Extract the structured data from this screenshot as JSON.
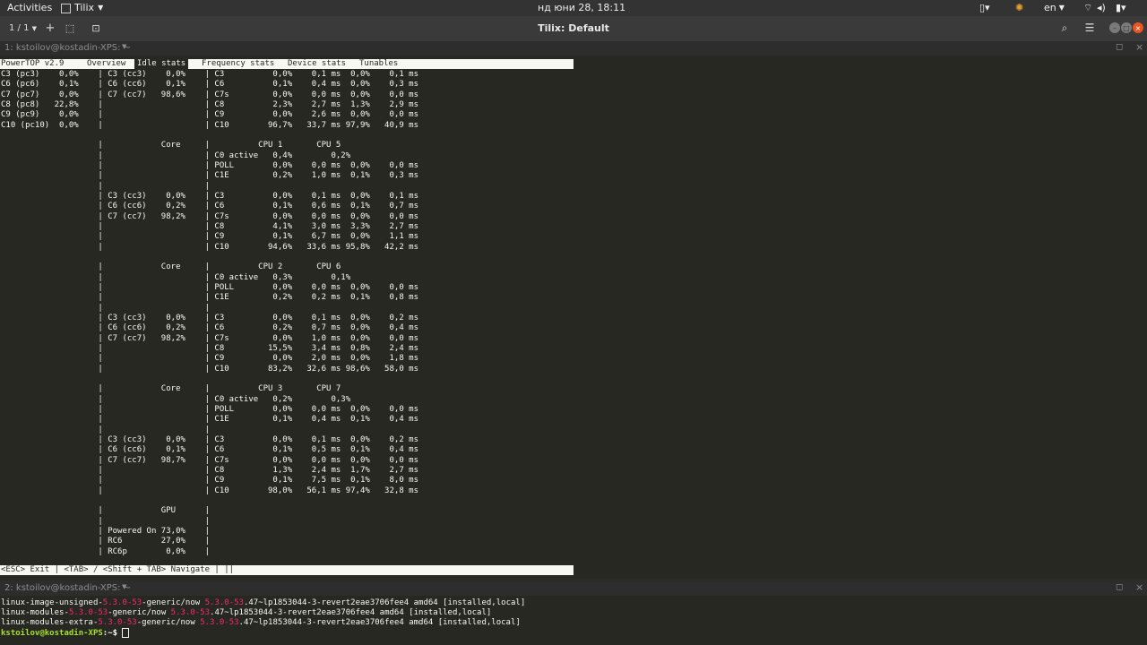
{
  "topbar": {
    "activities": "Activities",
    "app_menu": "Tilix",
    "clock": "нд юни 28, 18:11",
    "lang": "en"
  },
  "titlebar": {
    "session_counter": "1 / 1",
    "title": "Tilix: Default"
  },
  "pane1": {
    "title": "1: kstoilov@kostadin-XPS: ~",
    "tabs": [
      "PowerTOP v2.9",
      "Overview",
      "Idle stats",
      "Frequency stats",
      "Device stats",
      "Tunables"
    ],
    "lines": [
      "C3 (pc3)    0,0%    | C3 (cc3)    0,0%    | C3          0,0%    0,1 ms  0,0%    0,1 ms",
      "C6 (pc6)    0,1%    | C6 (cc6)    0,1%    | C6          0,1%    0,4 ms  0,0%    0,3 ms",
      "C7 (pc7)    0,0%    | C7 (cc7)   98,6%    | C7s         0,0%    0,0 ms  0,0%    0,0 ms",
      "C8 (pc8)   22,8%    |                     | C8          2,3%    2,7 ms  1,3%    2,9 ms",
      "C9 (pc9)    0,0%    |                     | C9          0,0%    2,6 ms  0,0%    0,0 ms",
      "C10 (pc10)  0,0%    |                     | C10        96,7%   33,7 ms 97,9%   40,9 ms",
      "",
      "                    |            Core     |          CPU 1       CPU 5",
      "                    |                     | C0 active   0,4%        0,2%",
      "                    |                     | POLL        0,0%    0,0 ms  0,0%    0,0 ms",
      "                    |                     | C1E         0,2%    1,0 ms  0,1%    0,3 ms",
      "                    |                     |",
      "                    | C3 (cc3)    0,0%    | C3          0,0%    0,1 ms  0,0%    0,1 ms",
      "                    | C6 (cc6)    0,2%    | C6          0,1%    0,6 ms  0,1%    0,7 ms",
      "                    | C7 (cc7)   98,2%    | C7s         0,0%    0,0 ms  0,0%    0,0 ms",
      "                    |                     | C8          4,1%    3,0 ms  3,3%    2,7 ms",
      "                    |                     | C9          0,1%    6,7 ms  0,0%    1,1 ms",
      "                    |                     | C10        94,6%   33,6 ms 95,8%   42,2 ms",
      "",
      "                    |            Core     |          CPU 2       CPU 6",
      "                    |                     | C0 active   0,3%        0,1%",
      "                    |                     | POLL        0,0%    0,0 ms  0,0%    0,0 ms",
      "                    |                     | C1E         0,2%    0,2 ms  0,1%    0,8 ms",
      "                    |                     |",
      "                    | C3 (cc3)    0,0%    | C3          0,0%    0,1 ms  0,0%    0,2 ms",
      "                    | C6 (cc6)    0,2%    | C6          0,2%    0,7 ms  0,0%    0,4 ms",
      "                    | C7 (cc7)   98,2%    | C7s         0,0%    1,0 ms  0,0%    0,0 ms",
      "                    |                     | C8         15,5%    3,4 ms  0,8%    2,4 ms",
      "                    |                     | C9          0,0%    2,0 ms  0,0%    1,8 ms",
      "                    |                     | C10        83,2%   32,6 ms 98,6%   58,0 ms",
      "",
      "                    |            Core     |          CPU 3       CPU 7",
      "                    |                     | C0 active   0,2%        0,3%",
      "                    |                     | POLL        0,0%    0,0 ms  0,0%    0,0 ms",
      "                    |                     | C1E         0,1%    0,4 ms  0,1%    0,4 ms",
      "                    |                     |",
      "                    | C3 (cc3)    0,0%    | C3          0,0%    0,1 ms  0,0%    0,2 ms",
      "                    | C6 (cc6)    0,1%    | C6          0,1%    0,5 ms  0,1%    0,4 ms",
      "                    | C7 (cc7)   98,7%    | C7s         0,0%    0,0 ms  0,0%    0,0 ms",
      "                    |                     | C8          1,3%    2,4 ms  1,7%    2,7 ms",
      "                    |                     | C9          0,1%    7,5 ms  0,1%    8,0 ms",
      "                    |                     | C10        98,0%   56,1 ms 97,4%   32,8 ms",
      "",
      "                    |            GPU      |",
      "                    |                     |",
      "                    | Powered On 73,0%    |",
      "                    | RC6        27,0%    |",
      "                    | RC6p        0,0%    |"
    ],
    "footer": "<ESC> Exit | <TAB> / <Shift + TAB> Navigate | ||"
  },
  "pane2": {
    "title": "2: kstoilov@kostadin-XPS: ~",
    "lines": [
      {
        "a": "linux-image-unsigned-",
        "b": "5.3.0-53",
        "c": "-generic/now ",
        "d": "5.3.0-53",
        "e": ".47~lp1853044-3-revert2eae3706fee4 amd64 [installed,local]"
      },
      {
        "a": "linux-modules-",
        "b": "5.3.0-53",
        "c": "-generic/now ",
        "d": "5.3.0-53",
        "e": ".47~lp1853044-3-revert2eae3706fee4 amd64 [installed,local]"
      },
      {
        "a": "linux-modules-extra-",
        "b": "5.3.0-53",
        "c": "-generic/now ",
        "d": "5.3.0-53",
        "e": ".47~lp1853044-3-revert2eae3706fee4 amd64 [installed,local]"
      }
    ],
    "prompt_user": "kstoilov@kostadin-XPS",
    "prompt_rest": ":~$ "
  },
  "colors": {
    "terminal_bg": "#272822",
    "terminal_fg": "#f8f8f2",
    "version_highlight": "#f92672",
    "prompt": "#a6e22e",
    "close_button": "#e95420"
  },
  "icons": [
    "chevron-down-icon",
    "plus-icon",
    "add-session-icon",
    "sync-input-icon",
    "search-icon",
    "hamburger-menu-icon",
    "maximize-icon",
    "close-icon",
    "minimize-icon",
    "restore-icon",
    "battery-icon",
    "wifi-icon",
    "volume-icon",
    "night-light-icon",
    "clipboard-icon"
  ]
}
